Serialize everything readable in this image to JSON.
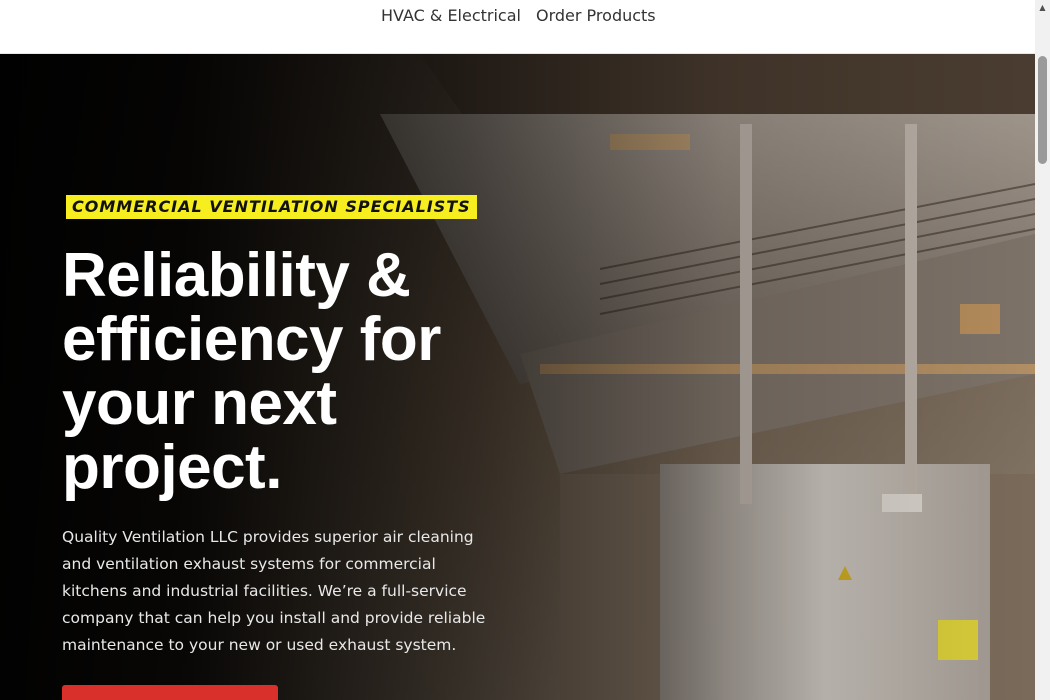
{
  "nav": {
    "items": [
      {
        "label": "HVAC & Electrical"
      },
      {
        "label": "Order Products"
      }
    ]
  },
  "hero": {
    "eyebrow": "COMMERCIAL VENTILATION SPECIALISTS",
    "headline": "Reliability & efficiency for your next project.",
    "body": "Quality Ventilation LLC provides superior air cleaning and ventilation exhaust systems for commercial kitchens and industrial facilities. We’re a full-service company that can help you install and provide reliable maintenance to your new or used exhaust system.",
    "cta_color": "#d9302c",
    "eyebrow_color": "#f6ee1f"
  },
  "icons": {
    "scroll_up": "triangle-up-icon",
    "caution": "warning-triangle-icon"
  }
}
